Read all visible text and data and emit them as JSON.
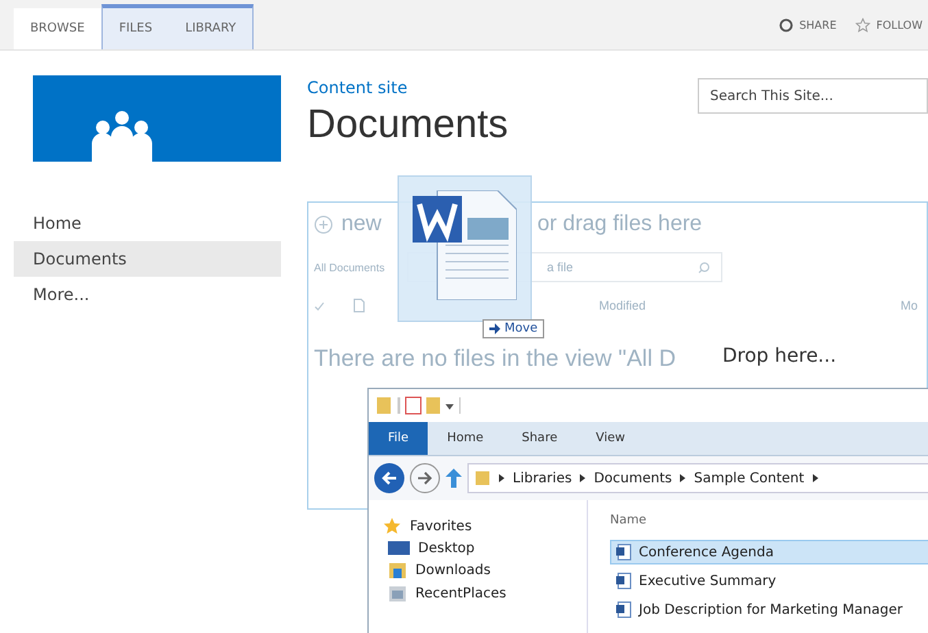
{
  "ribbon": {
    "tabs": [
      {
        "label": "BROWSE",
        "selected": true
      },
      {
        "label": "FILES",
        "selected": false
      },
      {
        "label": "LIBRARY",
        "selected": false
      }
    ],
    "actions": [
      "SHARE",
      "FOLLOW"
    ]
  },
  "site": {
    "link": "Content site",
    "title": "Documents",
    "search": {
      "placeholder": "Search This Site..."
    }
  },
  "nav": [
    {
      "label": "Home",
      "selected": false
    },
    {
      "label": "Documents",
      "selected": true
    },
    {
      "label": "More...",
      "selected": false
    }
  ],
  "library": {
    "upload_parts": [
      "new",
      "or drag files here"
    ],
    "view": "All Documents",
    "find_placeholder": "a file",
    "columns": [
      "Modified",
      "Mo"
    ],
    "empty": "There are no files in the view \"All D"
  },
  "drag": {
    "badge": "Move",
    "drop_hint": "Drop here..."
  },
  "explorer": {
    "tabs": [
      {
        "label": "File",
        "selected": true
      },
      {
        "label": "Home",
        "selected": false
      },
      {
        "label": "Share",
        "selected": false
      },
      {
        "label": "View",
        "selected": false
      }
    ],
    "path": [
      "Libraries",
      "Documents",
      "Sample Content"
    ],
    "nav": [
      {
        "label": "Favorites",
        "kind": "star"
      },
      {
        "label": "Desktop",
        "kind": "desktop"
      },
      {
        "label": "Downloads",
        "kind": "downloads"
      },
      {
        "label": "RecentPlaces",
        "kind": "recent"
      }
    ],
    "column": "Name",
    "files": [
      {
        "name": "Conference Agenda",
        "selected": true
      },
      {
        "name": "Executive Summary",
        "selected": false
      },
      {
        "name": "Job Description for Marketing Manager",
        "selected": false
      }
    ]
  }
}
